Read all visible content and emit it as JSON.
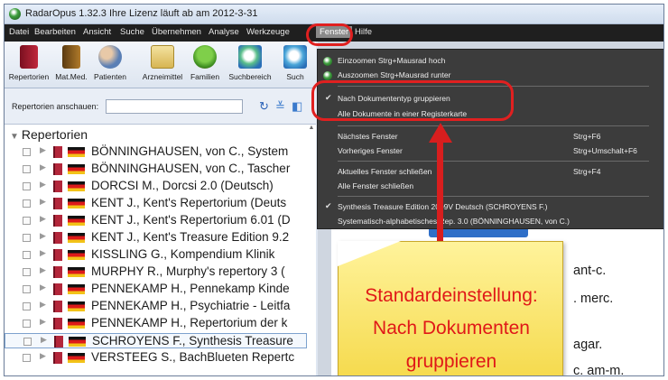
{
  "window": {
    "title": "RadarOpus 1.32.3  Ihre Lizenz läuft ab am 2012-3-31"
  },
  "menubar": {
    "items": [
      "Datei",
      "Bearbeiten",
      "Ansicht",
      "Suche",
      "Übernehmen",
      "Analyse",
      "Werkzeuge",
      "Fenster",
      "Hilfe"
    ],
    "active": "Fenster"
  },
  "toolbar": {
    "buttons": [
      {
        "label": "Repertorien",
        "icon": "red-book-icon"
      },
      {
        "label": "Mat.Med.",
        "icon": "brown-book-icon"
      },
      {
        "label": "Patienten",
        "icon": "patients-icon"
      },
      {
        "label": "Arzneimittel",
        "icon": "remedies-icon"
      },
      {
        "label": "Familien",
        "icon": "tree-icon"
      },
      {
        "label": "Suchbereich",
        "icon": "search-area-icon"
      },
      {
        "label": "Such",
        "icon": "search-icon"
      }
    ]
  },
  "filter": {
    "label": "Repertorien anschauen:"
  },
  "tree": {
    "root_label": "Repertorien",
    "items": [
      {
        "label": "BÖNNINGHAUSEN, von C., System"
      },
      {
        "label": "BÖNNINGHAUSEN, von C., Tascher"
      },
      {
        "label": "DORCSI M., Dorcsi 2.0 (Deutsch)"
      },
      {
        "label": "KENT J., Kent's Repertorium (Deuts"
      },
      {
        "label": "KENT J., Kent's Repertorium 6.01 (D"
      },
      {
        "label": "KENT J., Kent's Treasure Edition 9.2"
      },
      {
        "label": "KISSLING G., Kompendium Klinik"
      },
      {
        "label": "MURPHY R., Murphy's repertory 3 ("
      },
      {
        "label": "PENNEKAMP H., Pennekamp Kinde"
      },
      {
        "label": "PENNEKAMP H., Psychiatrie - Leitfa"
      },
      {
        "label": "PENNEKAMP H., Repertorium der k"
      },
      {
        "label": "SCHROYENS F., Synthesis Treasure"
      },
      {
        "label": "VERSTEEG S., BachBlueten Repertc"
      }
    ],
    "selected_index": 11
  },
  "fenster_menu": {
    "items": [
      {
        "label": "Einzoomen Strg+Mausrad hoch",
        "shortcut": ""
      },
      {
        "label": "Auszoomen Strg+Mausrad runter",
        "shortcut": ""
      },
      {
        "label": "Nach Dokumententyp gruppieren",
        "shortcut": "",
        "checked": true
      },
      {
        "label": "Alle Dokumente in einer Registerkarte",
        "shortcut": ""
      },
      {
        "label": "Nächstes Fenster",
        "shortcut": "Strg+F6"
      },
      {
        "label": "Vorheriges Fenster",
        "shortcut": "Strg+Umschalt+F6"
      },
      {
        "label": "Aktuelles Fenster schließen",
        "shortcut": "Strg+F4"
      },
      {
        "label": "Alle Fenster schließen",
        "shortcut": ""
      },
      {
        "label": "Synthesis Treasure Edition 2009V Deutsch (SCHROYENS F.)",
        "shortcut": "",
        "checked": true
      },
      {
        "label": "Systematisch-alphabetisches Rep. 3.0 (BÖNNINGHAUSEN, von C.)",
        "shortcut": ""
      }
    ]
  },
  "document_text": [
    "ant-c.",
    ". merc.",
    "agar.",
    "c. am-m."
  ],
  "annotation": {
    "line1": "Standardeinstellung:",
    "line2": "Nach Dokumenten",
    "line3": "gruppieren",
    "color": "#e01818"
  }
}
